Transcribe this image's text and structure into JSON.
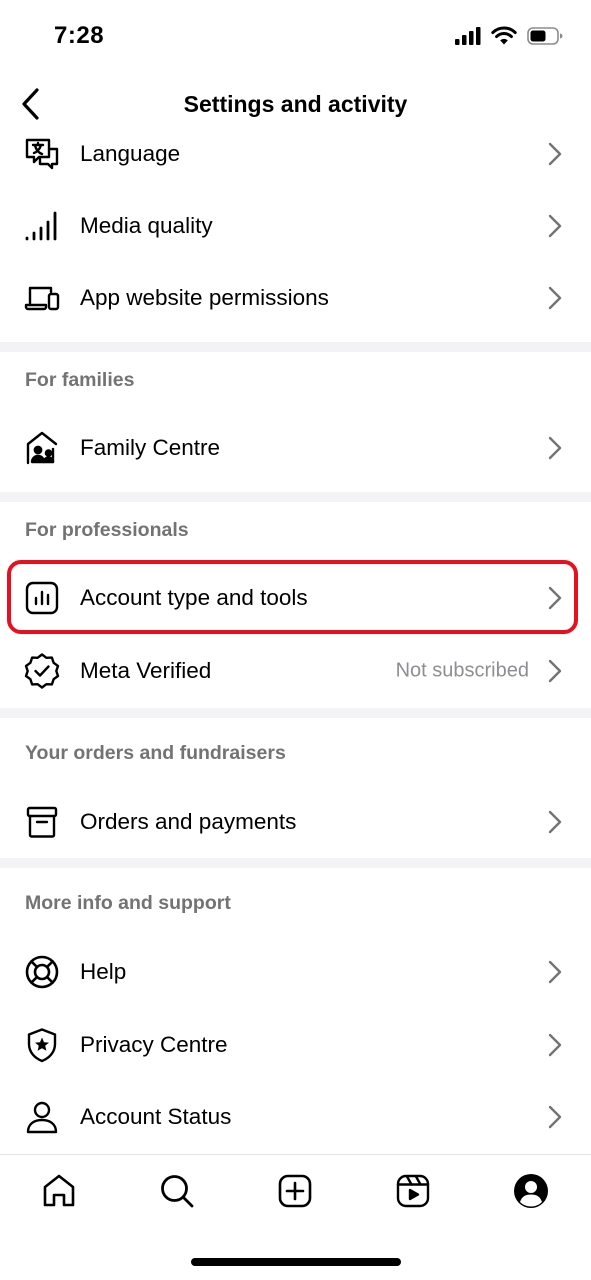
{
  "status_bar": {
    "time": "7:28",
    "icons": [
      "cellular-signal-icon",
      "wifi-icon",
      "battery-icon"
    ]
  },
  "header": {
    "back_icon": "chevron-left-icon",
    "title": "Settings and activity"
  },
  "rows_top": [
    {
      "label": "Language",
      "icon": "language-icon"
    },
    {
      "label": "Media quality",
      "icon": "signal-bars-icon"
    },
    {
      "label": "App website permissions",
      "icon": "devices-icon"
    }
  ],
  "sections": {
    "families": {
      "title": "For families",
      "items": [
        {
          "label": "Family Centre",
          "icon": "family-home-icon"
        }
      ]
    },
    "professionals": {
      "title": "For professionals",
      "items": [
        {
          "label": "Account type and tools",
          "icon": "bar-chart-icon",
          "highlighted": true
        },
        {
          "label": "Meta Verified",
          "icon": "verified-badge-icon",
          "value": "Not subscribed"
        }
      ]
    },
    "orders": {
      "title": "Your orders and fundraisers",
      "items": [
        {
          "label": "Orders and payments",
          "icon": "package-icon"
        }
      ]
    },
    "support": {
      "title": "More info and support",
      "items": [
        {
          "label": "Help",
          "icon": "lifebuoy-icon"
        },
        {
          "label": "Privacy Centre",
          "icon": "shield-star-icon"
        },
        {
          "label": "Account Status",
          "icon": "person-icon"
        }
      ]
    }
  },
  "tab_bar": {
    "tabs": [
      "home-icon",
      "search-icon",
      "create-plus-icon",
      "reels-icon",
      "profile-icon"
    ]
  },
  "colors": {
    "highlight": "#e8101e",
    "section_title": "#737373",
    "secondary_text": "#8e8e93",
    "divider": "#f3f3f5"
  }
}
